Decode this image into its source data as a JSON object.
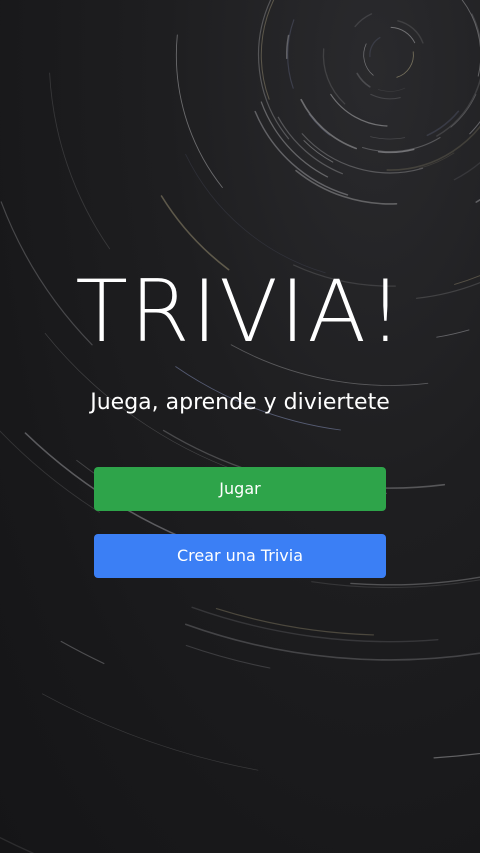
{
  "app": {
    "title": "TRIVIA!",
    "subtitle": "Juega, aprende y diviertete"
  },
  "actions": {
    "play_label": "Jugar",
    "create_label": "Crear una Trivia"
  },
  "background": {
    "image": "star-trails-photo"
  },
  "colors": {
    "play_button": "#2ea44a",
    "create_button": "#3b7ff5",
    "text": "#ffffff",
    "background": "#1b1b1d"
  }
}
